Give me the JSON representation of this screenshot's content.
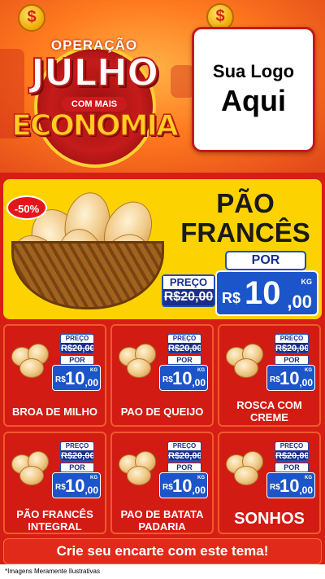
{
  "header": {
    "badge_top": "OPERAÇÃO",
    "badge_main": "JULHO",
    "badge_mid": "COM MAIS",
    "badge_bottom": "ECONOMIA",
    "coin_symbol": "$",
    "logo_line1": "Sua Logo",
    "logo_line2": "Aqui"
  },
  "hero": {
    "discount": "-50%",
    "title_line1": "PÃO",
    "title_line2": "FRANCÊS",
    "preco_label": "PREÇO",
    "old_price": "R$20,00",
    "por_label": "POR",
    "currency": "R$",
    "price_int": "10",
    "price_cents": ",00",
    "unit": "KG"
  },
  "products": [
    {
      "name": "BROA DE MILHO",
      "preco_label": "PREÇO",
      "old_price": "R$20,00",
      "por_label": "POR",
      "currency": "R$",
      "price_int": "10",
      "price_cents": ",00",
      "unit": "KG",
      "icon": "broa-icon"
    },
    {
      "name": "PAO DE QUEIJO",
      "preco_label": "PREÇO",
      "old_price": "R$20,00",
      "por_label": "POR",
      "currency": "R$",
      "price_int": "10",
      "price_cents": ",00",
      "unit": "KG",
      "icon": "pao-de-queijo-icon"
    },
    {
      "name": "ROSCA COM CREME",
      "preco_label": "PREÇO",
      "old_price": "R$20,00",
      "por_label": "POR",
      "currency": "R$",
      "price_int": "10",
      "price_cents": ",00",
      "unit": "KG",
      "icon": "rosca-icon"
    },
    {
      "name": "PÃO FRANCÊS INTEGRAL",
      "preco_label": "PREÇO",
      "old_price": "R$20,00",
      "por_label": "POR",
      "currency": "R$",
      "price_int": "10",
      "price_cents": ",00",
      "unit": "KG",
      "icon": "pao-integral-icon"
    },
    {
      "name": "PAO DE BATATA PADARIA",
      "preco_label": "PREÇO",
      "old_price": "R$20,00",
      "por_label": "POR",
      "currency": "R$",
      "price_int": "10",
      "price_cents": ",00",
      "unit": "KG",
      "icon": "pao-batata-icon"
    },
    {
      "name": "SONHOS",
      "preco_label": "PREÇO",
      "old_price": "R$20,00",
      "por_label": "POR",
      "currency": "R$",
      "price_int": "10",
      "price_cents": ",00",
      "unit": "KG",
      "icon": "sonho-icon"
    }
  ],
  "cta": "Crie seu encarte com este tema!",
  "footer_note": "*Imagens Meramente Ilustrativas",
  "colors": {
    "red": "#d21b13",
    "yellow": "#fcd200",
    "blue": "#1c55c9",
    "navy": "#1a2e8a"
  }
}
